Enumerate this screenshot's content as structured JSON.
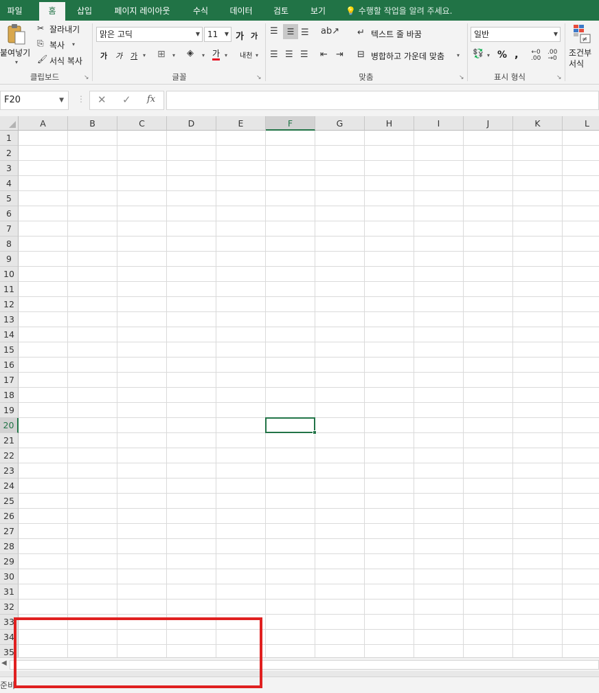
{
  "tabs": [
    {
      "label": "파일"
    },
    {
      "label": "홈"
    },
    {
      "label": "삽입"
    },
    {
      "label": "페이지 레이아웃"
    },
    {
      "label": "수식"
    },
    {
      "label": "데이터"
    },
    {
      "label": "검토"
    },
    {
      "label": "보기"
    }
  ],
  "tell_me": "수행할 작업을 알려 주세요.",
  "ribbon": {
    "clipboard": {
      "paste": "붙여넣기",
      "cut": "잘라내기",
      "copy": "복사",
      "format_painter": "서식 복사",
      "group": "클립보드"
    },
    "font": {
      "name": "맑은 고딕",
      "size": "11",
      "grow": "가",
      "shrink": "가",
      "bold": "가",
      "italic": "가",
      "underline": "가",
      "font_color": "가",
      "phonetic": "내천",
      "group": "글꼴"
    },
    "alignment": {
      "wrap": "텍스트 줄 바꿈",
      "merge": "병합하고 가운데 맞춤",
      "group": "맞춤"
    },
    "number": {
      "format": "일반",
      "percent": "%",
      "comma": ",",
      "group": "표시 형식"
    },
    "styles": {
      "conditional_line1": "조건부",
      "conditional_line2": "서식"
    }
  },
  "formula_bar": {
    "name_box": "F20",
    "cancel": "✕",
    "enter": "✓",
    "fx": "fx",
    "value": ""
  },
  "columns": [
    "A",
    "B",
    "C",
    "D",
    "E",
    "F",
    "G",
    "H",
    "I",
    "J",
    "K",
    "L"
  ],
  "rows": [
    "1",
    "2",
    "3",
    "4",
    "5",
    "6",
    "7",
    "8",
    "9",
    "10",
    "11",
    "12",
    "13",
    "14",
    "15",
    "16",
    "17",
    "18",
    "19",
    "20",
    "21",
    "22",
    "23",
    "24",
    "25",
    "26",
    "27",
    "28",
    "29",
    "30",
    "31",
    "32",
    "33",
    "34",
    "35"
  ],
  "active_cell": {
    "column": "F",
    "row": "20"
  },
  "status": "준비",
  "colors": {
    "accent": "#217346",
    "annotation": "#e02020"
  }
}
